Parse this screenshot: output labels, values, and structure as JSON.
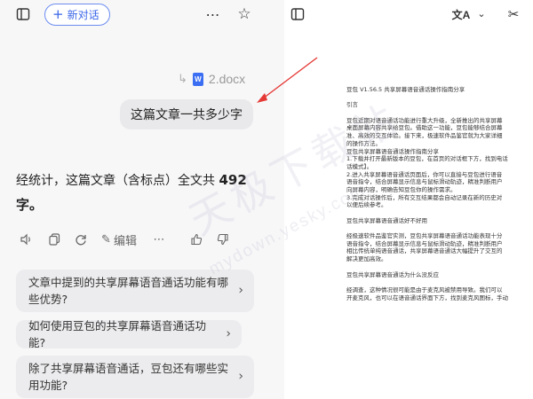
{
  "chat": {
    "new_chat_label": "新对话",
    "attachment": {
      "name": "2.docx",
      "badge": "W"
    },
    "user_message": "这篇文章一共多少字",
    "answer": {
      "prefix": "经统计，这篇文章（含标点）全文共 ",
      "count": "492",
      "suffix": "字。"
    },
    "actions": {
      "edit_label": "编辑"
    },
    "suggestions": [
      {
        "text": "文章中提到的共享屏幕语音通话功能有哪些优势?"
      },
      {
        "text": "如何使用豆包的共享屏幕语音通话功能?"
      },
      {
        "text": "除了共享屏幕语音通话，豆包还有哪些实用功能?"
      }
    ]
  },
  "preview": {
    "translate_label": "文A",
    "document_lines": [
      "豆包 V1.56.5 共享屏幕语音通话操作指南分享",
      "",
      "引言",
      "",
      "豆包近期对语音通话功能进行重大升级，全新推出的共享屏幕",
      "桌面屏幕内容共享给豆包。借助这一功能，豆包能够结合屏幕",
      "准、高效的交互体验。接下来，极速软件品鉴官就为大家详细",
      "的操作方法。",
      "豆包共享屏幕语音通话操作指南分享",
      "1.下载并打开最新版本的豆包，在首页的对话框下方，找到电话",
      "话模式】。",
      "2.进入共享屏幕语音通话页面后，你可以直接与豆包进行语音",
      "语音指令，结合屏幕显示信息与鼠标滑动轨迹，精准判断用户",
      "向屏幕内容，明确告知豆包你的操作需求。",
      "3.完成对话操作后，所有交互结果都会自动记录在新的历史对",
      "以便后续参考。",
      "",
      "豆包共享屏幕语音通话好不好用",
      "",
      "经极速软件品鉴官实测，豆包共享屏幕语音通话功能表现十分",
      "语音指令，结合屏幕显示信息与鼠标滑动轨迹，精准判断用户",
      "相比传统单纯语音通话，共享屏幕语音通话大幅提升了交互的",
      "解决更加高效。",
      "",
      "豆包共享屏幕语音通话为什么没反应",
      "",
      "经调查，这种情况很可能是由于麦克风被禁用导致。我们可以",
      "开麦克风，也可以在语音通话界面下方，找到麦克风图标，手动"
    ]
  },
  "watermark": {
    "main": "天极下载站",
    "sub": "mydown.yesky.com"
  },
  "colors": {
    "accent": "#3a66e8",
    "arrow": "#e53935",
    "docx": "#3b6ef2"
  }
}
